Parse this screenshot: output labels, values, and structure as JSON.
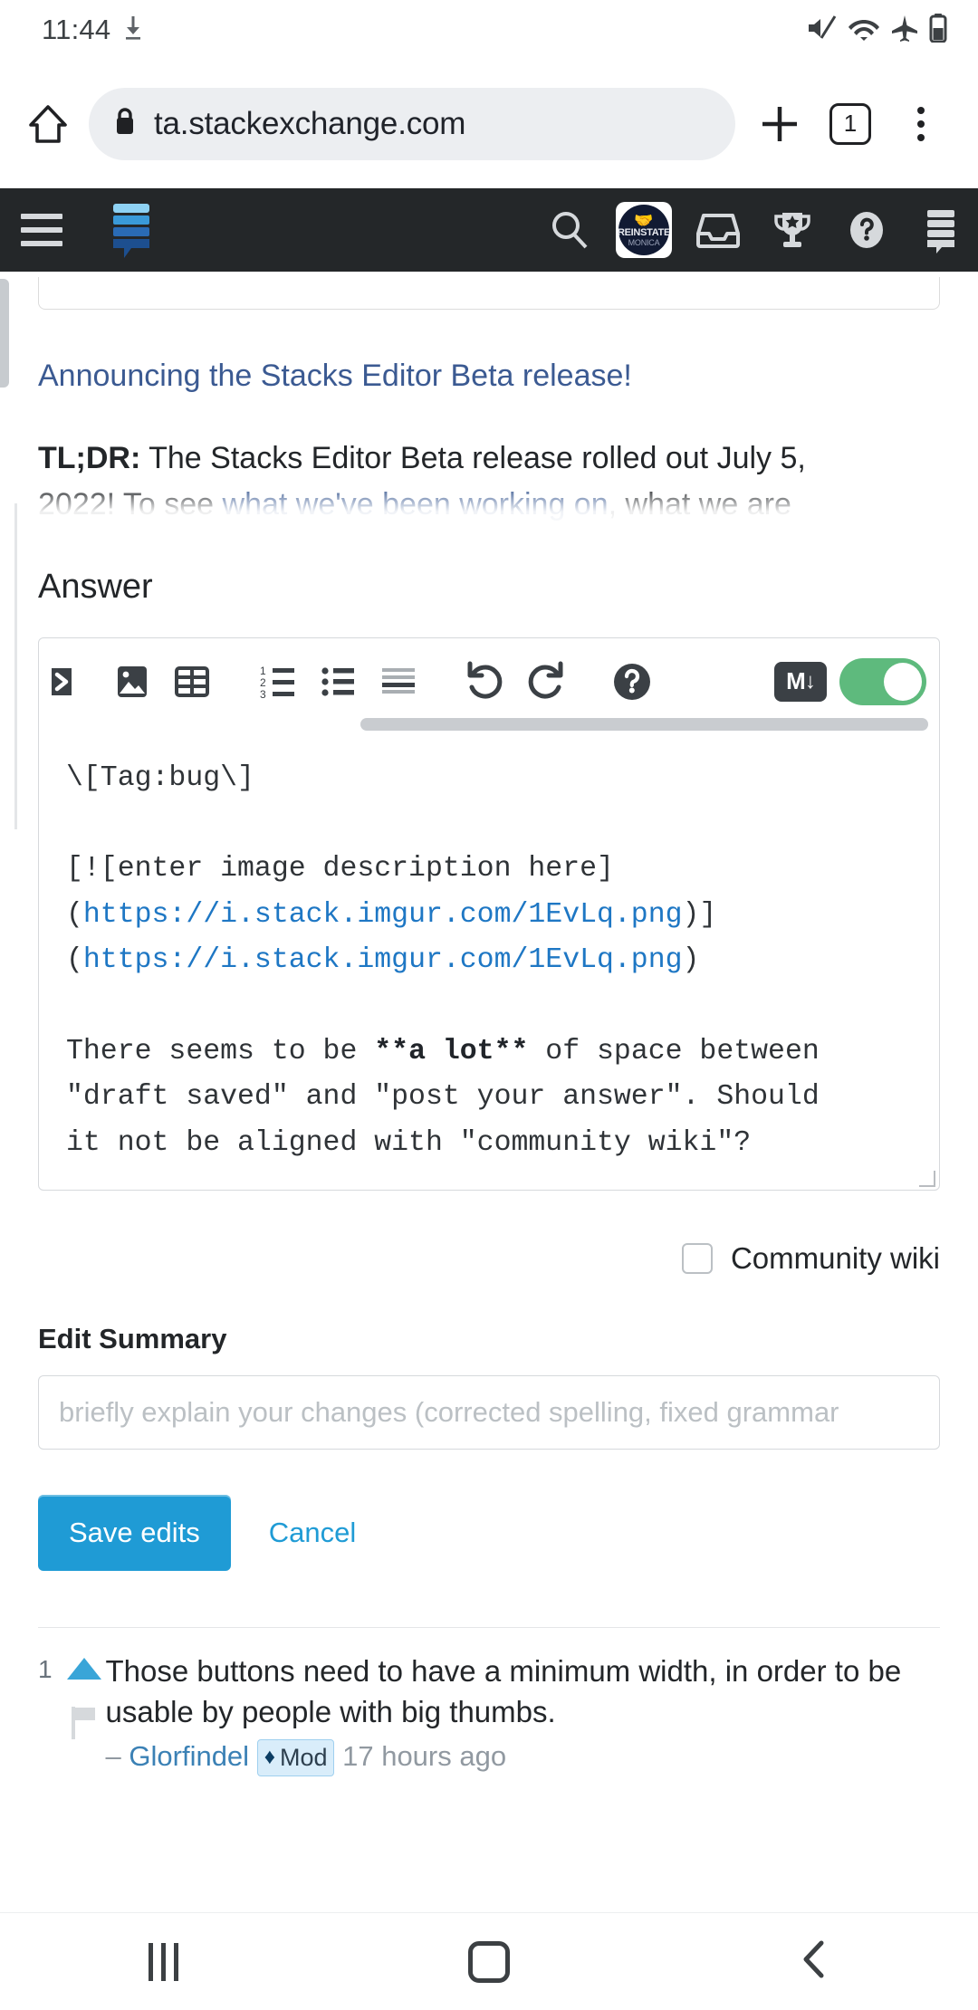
{
  "status_bar": {
    "clock": "11:44",
    "icons": [
      "download-icon",
      "mute-icon",
      "wifi-icon",
      "airplane-icon",
      "battery-icon"
    ]
  },
  "browser": {
    "url": "ta.stackexchange.com",
    "home_icon": "home-icon",
    "lock_icon": "lock-icon",
    "new_tab_icon": "plus-icon",
    "tab_count": "1",
    "menu_icon": "kebab-menu-icon"
  },
  "se_nav": {
    "menu_icon": "hamburger-icon",
    "logo": "stack-exchange-logo",
    "search_icon": "search-icon",
    "avatar": {
      "line1": "REINSTATE",
      "line2": "MONICA",
      "handshake": "🤝"
    },
    "inbox_icon": "inbox-icon",
    "achievements_icon": "trophy-icon",
    "help_icon": "help-circle-icon",
    "stacks_icon": "stacks-icon"
  },
  "notice": {
    "announcement_link": "Announcing the Stacks Editor Beta release!",
    "tldr_bold": "TL;DR:",
    "tldr_text": " The Stacks Editor Beta release rolled out July 5,",
    "tldr_line2_pre": "2022! To see ",
    "tldr_line2_link": "what we've been working on",
    "tldr_line2_post": ", what we are"
  },
  "answer_section": {
    "heading": "Answer"
  },
  "editor": {
    "toolbar": [
      {
        "name": "code-block-icon",
        "glyph": "code"
      },
      {
        "name": "image-icon",
        "glyph": "image"
      },
      {
        "name": "table-icon",
        "glyph": "table"
      },
      {
        "name": "ordered-list-icon",
        "glyph": "ol"
      },
      {
        "name": "bulleted-list-icon",
        "glyph": "ul"
      },
      {
        "name": "blockquote-icon",
        "glyph": "lines"
      },
      {
        "name": "undo-icon",
        "glyph": "undo"
      },
      {
        "name": "redo-icon",
        "glyph": "redo"
      },
      {
        "name": "editor-help-icon",
        "glyph": "help"
      }
    ],
    "markdown_badge": "M",
    "markdown_toggle_state": "on",
    "toggle_color": "#5eba7d",
    "body_lines": [
      {
        "text": "\\[Tag:bug\\]",
        "type": "plain"
      },
      {
        "text": "",
        "type": "plain"
      },
      {
        "text": "[![enter image description here]",
        "type": "plain"
      },
      {
        "text": "(https://i.stack.imgur.com/1EvLq.png)]",
        "type": "link-open"
      },
      {
        "text": "(https://i.stack.imgur.com/1EvLq.png)",
        "type": "link-open"
      },
      {
        "text": "",
        "type": "plain"
      },
      {
        "text": "There seems to be **a lot** of space between",
        "type": "bold-mid"
      },
      {
        "text": "\"draft saved\" and \"post your answer\". Should",
        "type": "plain"
      },
      {
        "text": "it not be aligned with \"community wiki\"?",
        "type": "plain"
      }
    ]
  },
  "options": {
    "community_wiki_label": "Community wiki",
    "community_wiki_checked": false,
    "edit_summary_label": "Edit Summary",
    "edit_summary_value": "",
    "edit_summary_placeholder": "briefly explain your changes (corrected spelling, fixed grammar"
  },
  "actions": {
    "save_label": "Save edits",
    "cancel_label": "Cancel",
    "primary_color": "#1f9bd5"
  },
  "comment": {
    "score": "1",
    "upvote_icon": "upvote-triangle-icon",
    "flag_icon": "flag-icon",
    "text": "Those buttons need to have a minimum width, in order to be usable by people with big thumbs.",
    "dash": "–",
    "author": "Glorfindel",
    "mod_badge": "Mod",
    "mod_diamond": "♦",
    "timestamp": "17 hours ago"
  },
  "android_nav": {
    "recents_icon": "recents-icon",
    "home_icon": "home-square-icon",
    "back_icon": "back-chevron-icon"
  }
}
